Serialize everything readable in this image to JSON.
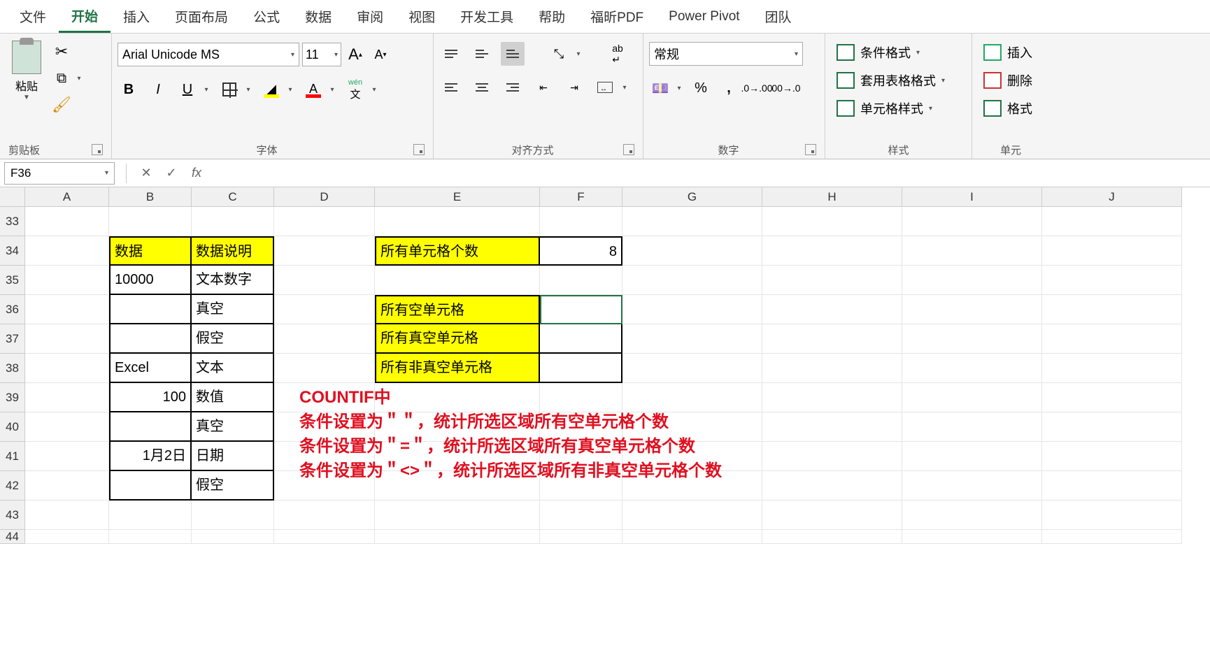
{
  "tabs": [
    "文件",
    "开始",
    "插入",
    "页面布局",
    "公式",
    "数据",
    "审阅",
    "视图",
    "开发工具",
    "帮助",
    "福昕PDF",
    "Power Pivot",
    "团队"
  ],
  "activeTab": 1,
  "ribbon": {
    "clipboard": {
      "label": "剪贴板",
      "paste": "粘贴"
    },
    "font": {
      "label": "字体",
      "name": "Arial Unicode MS",
      "size": "11",
      "wen": "wén",
      "wenChar": "文"
    },
    "align": {
      "label": "对齐方式"
    },
    "number": {
      "label": "数字",
      "format": "常规"
    },
    "styles": {
      "label": "样式",
      "cond": "条件格式",
      "table": "套用表格格式",
      "cell": "单元格样式"
    },
    "cells": {
      "label": "单元",
      "insert": "插入",
      "delete": "删除",
      "format": "格式"
    }
  },
  "nameBox": "F36",
  "formula": "",
  "columns": [
    "A",
    "B",
    "C",
    "D",
    "E",
    "F",
    "G",
    "H",
    "I",
    "J"
  ],
  "rowStart": 33,
  "rowEnd": 44,
  "cells": {
    "B34": "数据",
    "C34": "数据说明",
    "B35": "10000",
    "C35": "文本数字",
    "C36": "真空",
    "C37": "假空",
    "B38": "Excel",
    "C38": "文本",
    "B39": "100",
    "C39": "数值",
    "C40": "真空",
    "B41": "1月2日",
    "C41": "日期",
    "C42": "假空",
    "E34": "所有单元格个数",
    "F34": "8",
    "E36": "所有空单元格",
    "E37": "所有真空单元格",
    "E38": "所有非真空单元格"
  },
  "notes": {
    "title": "COUNTIF中",
    "l1": "条件设置为＂＂，统计所选区域所有空单元格个数",
    "l2": "条件设置为＂=＂，统计所选区域所有真空单元格个数",
    "l3": "条件设置为＂<>＂，统计所选区域所有非真空单元格个数"
  }
}
